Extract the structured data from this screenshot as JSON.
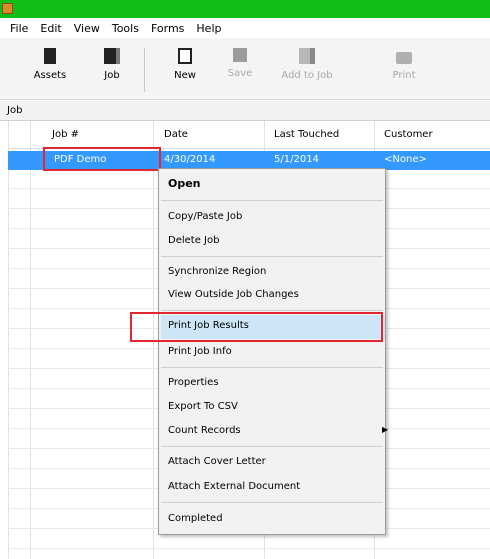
{
  "menus": [
    "File",
    "Edit",
    "View",
    "Tools",
    "Forms",
    "Help"
  ],
  "toolbar": {
    "assets": "Assets",
    "job": "Job",
    "new": "New",
    "save": "Save",
    "add_to_job": "Add to Job",
    "print": "Print"
  },
  "section": {
    "label": "Job"
  },
  "grid": {
    "columns": [
      "Job #",
      "Date",
      "Last Touched",
      "Customer"
    ],
    "rows": [
      {
        "job": "PDF Demo",
        "date": "4/30/2014",
        "last_touched": "5/1/2014",
        "customer": "<None>"
      }
    ]
  },
  "context_menu": {
    "items": {
      "open": "Open",
      "copy_paste_job": "Copy/Paste Job",
      "delete_job": "Delete Job",
      "synchronize_region": "Synchronize Region",
      "view_outside_job_changes": "View Outside Job Changes",
      "print_job_results": "Print Job Results",
      "print_job_info": "Print Job Info",
      "properties": "Properties",
      "export_to_csv": "Export To CSV",
      "count_records": "Count Records",
      "attach_cover_letter": "Attach Cover Letter",
      "attach_external_document": "Attach External Document",
      "completed": "Completed"
    },
    "submenu_arrow": "▶"
  },
  "colors": {
    "title_bar": "#0fbf17",
    "selection": "#3399ff",
    "hover": "#cce6f7",
    "highlight_box": "#e0282e"
  }
}
